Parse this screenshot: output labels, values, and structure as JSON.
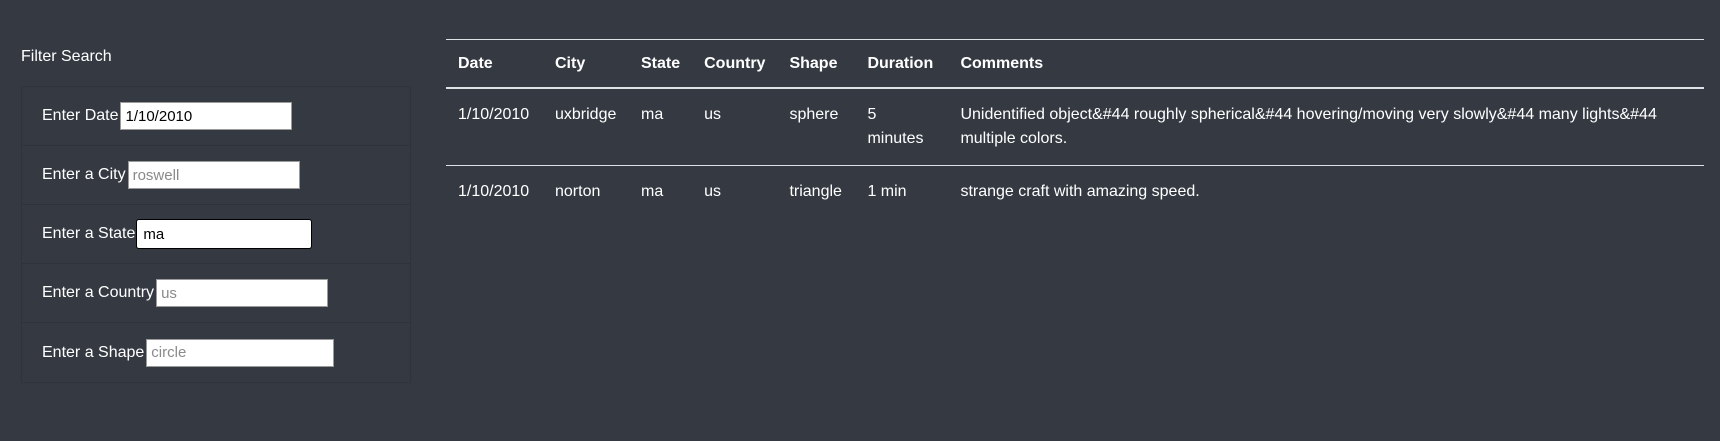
{
  "filter": {
    "title": "Filter Search",
    "fields": [
      {
        "label": "Enter Date",
        "value": "1/10/2010",
        "placeholder": ""
      },
      {
        "label": "Enter a City",
        "value": "",
        "placeholder": "roswell"
      },
      {
        "label": "Enter a State",
        "value": "ma",
        "placeholder": ""
      },
      {
        "label": "Enter a Country",
        "value": "",
        "placeholder": "us"
      },
      {
        "label": "Enter a Shape",
        "value": "",
        "placeholder": "circle"
      }
    ]
  },
  "table": {
    "headers": [
      "Date",
      "City",
      "State",
      "Country",
      "Shape",
      "Duration",
      "Comments"
    ],
    "rows": [
      [
        "1/10/2010",
        "uxbridge",
        "ma",
        "us",
        "sphere",
        "5 minutes",
        "Unidentified object&#44 roughly spherical&#44 hovering/moving very slowly&#44 many lights&#44 multiple colors."
      ],
      [
        "1/10/2010",
        "norton",
        "ma",
        "us",
        "triangle",
        "1 min",
        "strange craft with amazing speed."
      ]
    ]
  },
  "colors": {
    "background": "#353a42",
    "text": "#ffffff",
    "table_border": "#dee2e6"
  }
}
